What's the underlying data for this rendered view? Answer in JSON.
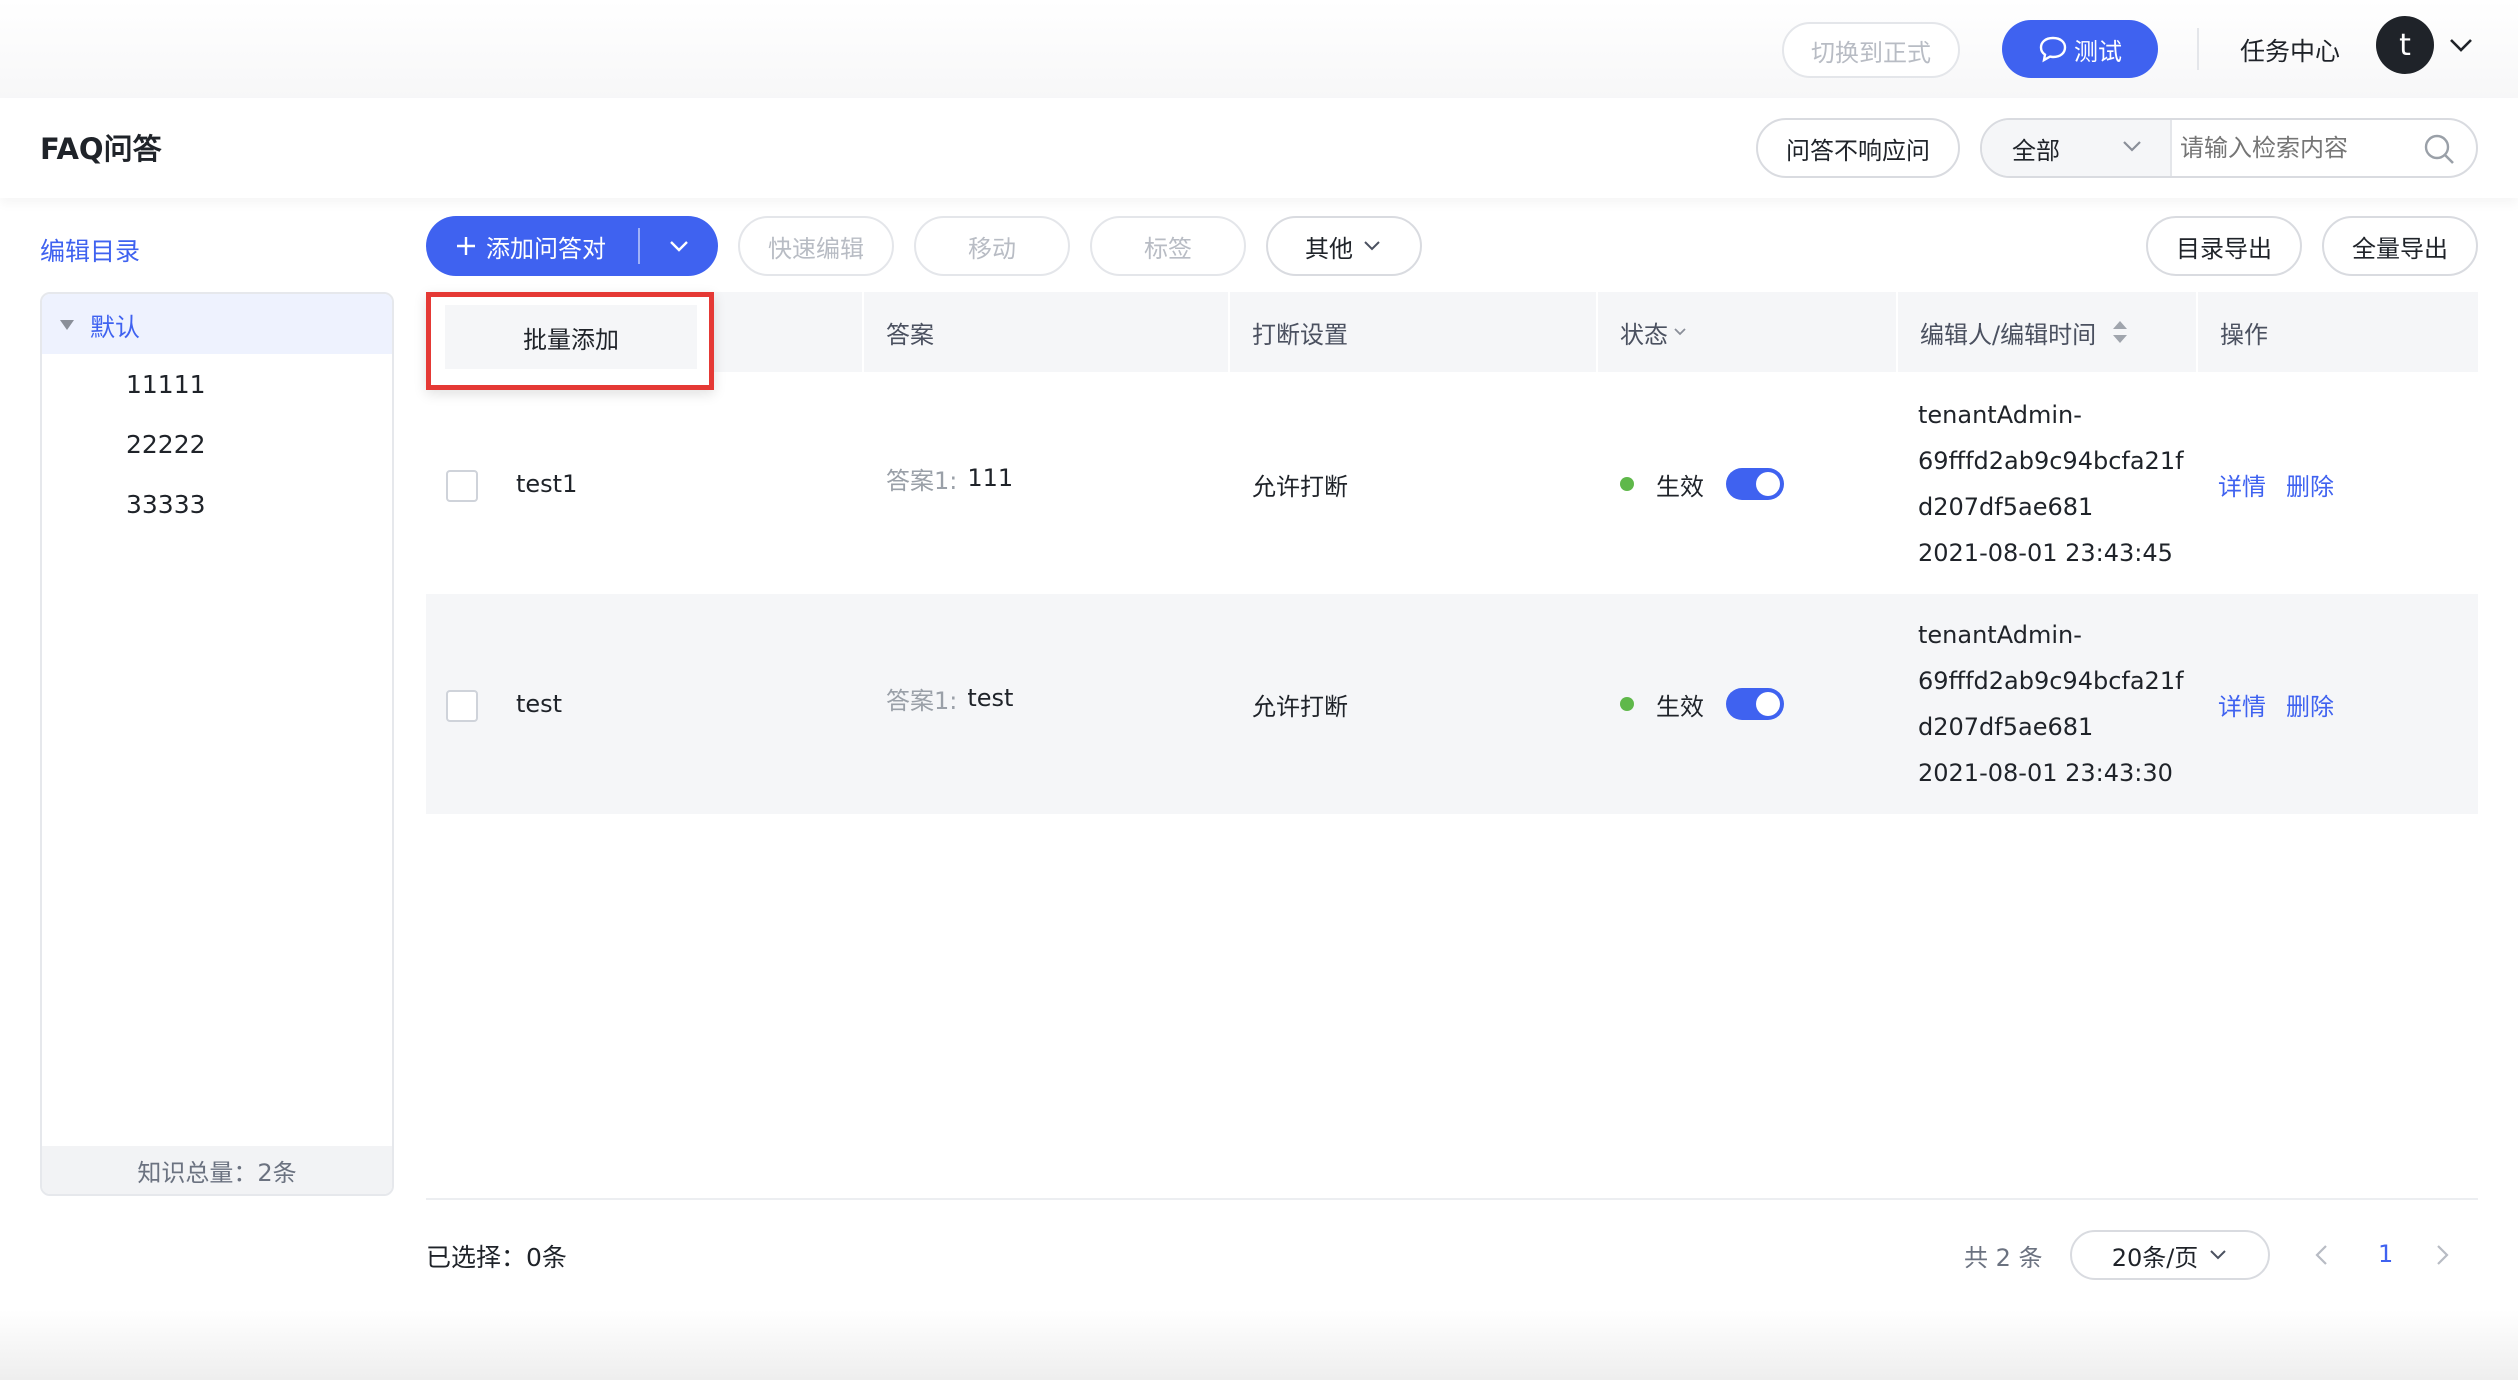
{
  "topbar": {
    "switch_label": "切换到正式",
    "test_label": "测试",
    "task_center": "任务中心",
    "avatar_letter": "t"
  },
  "header": {
    "title": "FAQ问答",
    "no_response_label": "问答不响应问",
    "filter_value": "全部",
    "search_placeholder": "请输入检索内容"
  },
  "sidebar": {
    "edit_dir_label": "编辑目录",
    "root_label": "默认",
    "items": [
      "11111",
      "22222",
      "33333"
    ],
    "footer": "知识总量：2条"
  },
  "toolbar": {
    "add_label": "添加问答对",
    "quick_edit": "快速编辑",
    "move": "移动",
    "tag": "标签",
    "other": "其他",
    "export_dir": "目录导出",
    "export_all": "全量导出"
  },
  "dropdown": {
    "batch_add": "批量添加"
  },
  "table": {
    "headers": {
      "answer": "答案",
      "interrupt": "打断设置",
      "status": "状态",
      "editor": "编辑人/编辑时间",
      "actions": "操作"
    },
    "rows": [
      {
        "question": "test1",
        "answer_prefix": "答案1:",
        "answer": "111",
        "interrupt": "允许打断",
        "status": "生效",
        "editor_lines": [
          "tenantAdmin-",
          "69fffd2ab9c94bcfa21f",
          "d207df5ae681",
          "2021-08-01 23:43:45"
        ],
        "detail": "详情",
        "delete": "删除"
      },
      {
        "question": "test",
        "answer_prefix": "答案1:",
        "answer": "test",
        "interrupt": "允许打断",
        "status": "生效",
        "editor_lines": [
          "tenantAdmin-",
          "69fffd2ab9c94bcfa21f",
          "d207df5ae681",
          "2021-08-01 23:43:30"
        ],
        "detail": "详情",
        "delete": "删除"
      }
    ]
  },
  "footer": {
    "selected": "已选择：0条",
    "total": "共 2 条",
    "page_size": "20条/页",
    "current_page": "1"
  },
  "colors": {
    "primary": "#3f62f0",
    "status_green": "#5fb84a",
    "highlight_red": "#e53935"
  }
}
